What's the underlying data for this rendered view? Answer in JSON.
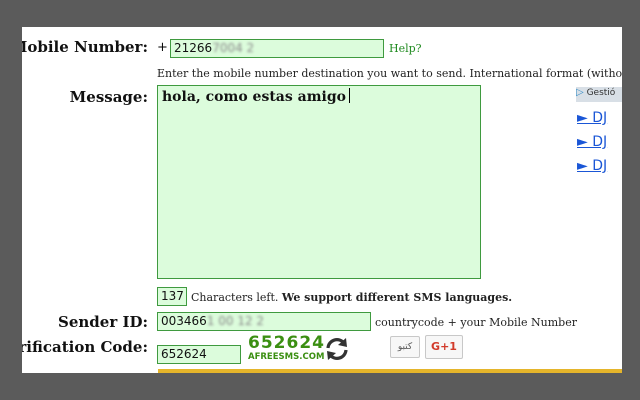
{
  "form": {
    "mobile": {
      "label": "Mobile Number:",
      "prefix": "+",
      "value_visible": "21266",
      "value_obscured": "7004 2",
      "help": "Help?",
      "hint": "Enter the mobile number destination you want to send. International format (without the leading z"
    },
    "message": {
      "label": "Message:",
      "value": "hola, como estas amigo"
    },
    "counter": {
      "value": "137",
      "text": "Characters left.",
      "bold_text": "We support different SMS languages."
    },
    "sender": {
      "label": "Sender ID:",
      "value_visible": "003466",
      "value_obscured": "1 00 12 2",
      "hint": "countrycode + your Mobile Number"
    },
    "verification": {
      "label": "Verification Code:",
      "value": "652624",
      "captcha_code": "652624",
      "captcha_site": "AFREESMS.COM",
      "refresh_icon": "refresh-icon"
    }
  },
  "ads": {
    "badge": "Gestió",
    "links": [
      "► DJ",
      "► DJ",
      "► DJ"
    ]
  },
  "social": {
    "tweet": "کتبو",
    "gplus": "G+1"
  },
  "colors": {
    "field_bg": "#dcfcdc",
    "field_border": "#3f9a3f",
    "link_blue": "#1a56d6",
    "captcha_green": "#3b8f12"
  }
}
